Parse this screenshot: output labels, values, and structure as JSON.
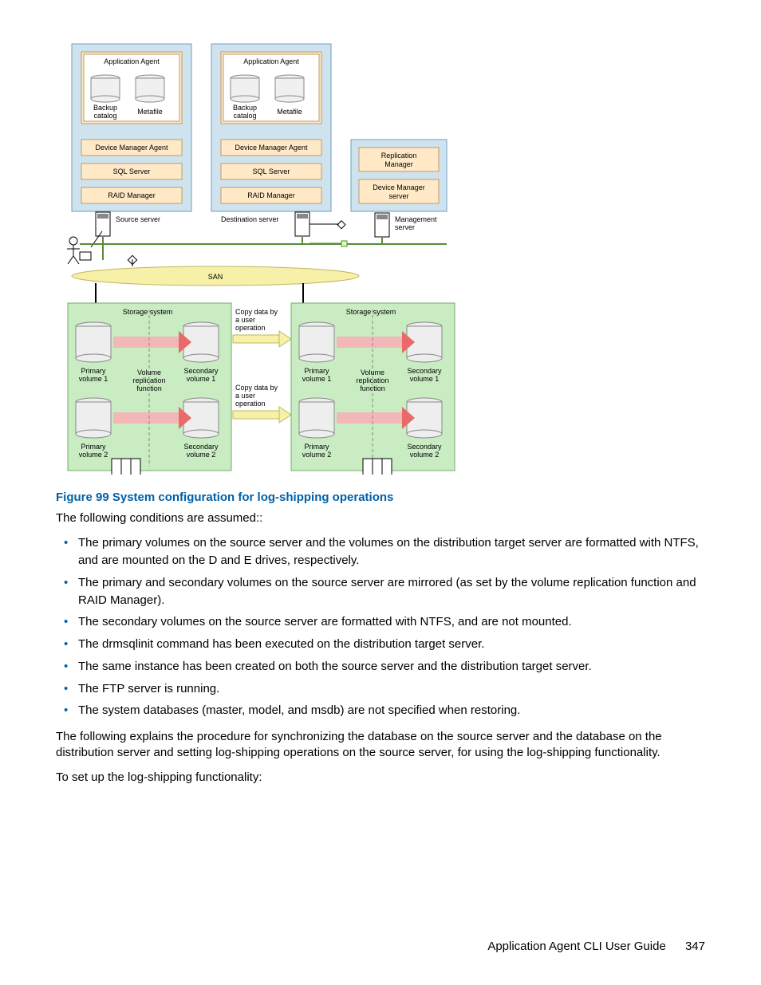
{
  "diagram": {
    "srcBox": {
      "appAgent": "Application Agent",
      "backup": "Backup",
      "catalog": "catalog",
      "metafile": "Metafile",
      "devMgr": "Device Manager Agent",
      "sql": "SQL Server",
      "raid": "RAID Manager",
      "server": "Source server"
    },
    "dstBox": {
      "appAgent": "Application Agent",
      "backup": "Backup",
      "catalog": "catalog",
      "metafile": "Metafile",
      "devMgr": "Device Manager Agent",
      "sql": "SQL Server",
      "raid": "RAID Manager",
      "server": "Destination server"
    },
    "mgmtBox": {
      "repMgr": "Replication",
      "repMgr2": "Manager",
      "devMgrSrv": "Device Manager",
      "devMgrSrv2": "server",
      "server": "Management",
      "server2": "server"
    },
    "san": "SAN",
    "storage1": {
      "title": "Storage system",
      "pv1a": "Primary",
      "pv1b": "volume 1",
      "sv1a": "Secondary",
      "sv1b": "volume 1",
      "pv2a": "Primary",
      "pv2b": "volume 2",
      "sv2a": "Secondary",
      "sv2b": "volume 2",
      "vra": "Volume",
      "vrb": "replication",
      "vrc": "function"
    },
    "storage2": {
      "title": "Storage system",
      "pv1a": "Primary",
      "pv1b": "volume 1",
      "sv1a": "Secondary",
      "sv1b": "volume 1",
      "pv2a": "Primary",
      "pv2b": "volume 2",
      "sv2a": "Secondary",
      "sv2b": "volume 2",
      "vra": "Volume",
      "vrb": "replication",
      "vrc": "function"
    },
    "copy1a": "Copy data by",
    "copy1b": "a user",
    "copy1c": "operation",
    "copy2a": "Copy data by",
    "copy2b": "a user",
    "copy2c": "operation"
  },
  "caption": "Figure 99 System configuration for log-shipping operations",
  "intro": "The following conditions are assumed::",
  "bullets": [
    "The primary volumes on the source server and the volumes on the distribution target server are formatted with NTFS, and are mounted on the D and E drives, respectively.",
    "The primary and secondary volumes on the source server are mirrored (as set by the volume replication function and RAID Manager).",
    "The secondary volumes on the source server are formatted with NTFS, and are not mounted.",
    "The drmsqlinit command has been executed on the distribution target server.",
    "The same instance has been created on both the source server and the distribution target server.",
    "The FTP server is running.",
    "The system databases (master, model, and msdb) are not specified when restoring."
  ],
  "para2": "The following explains the procedure for synchronizing the database on the source server and the database on the distribution server and setting log-shipping operations on the source server, for using the log-shipping functionality.",
  "para3": "To set up the log-shipping functionality:",
  "footer": {
    "title": "Application Agent CLI User Guide",
    "page": "347"
  }
}
